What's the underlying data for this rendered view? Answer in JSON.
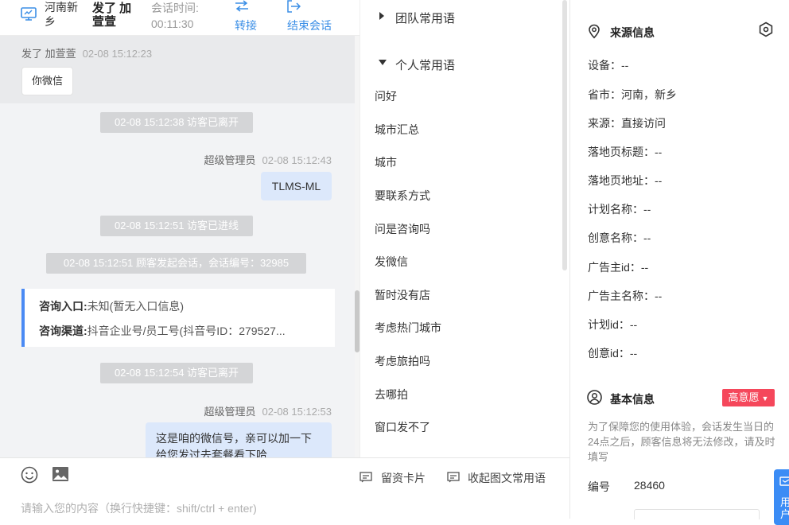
{
  "header": {
    "location": "河南新乡",
    "visitor_name": "发了 加萱萱",
    "session_time_label": "会话时间:",
    "session_time": "00:11:30",
    "transfer_label": "转接",
    "end_session_label": "结束会话"
  },
  "messages": {
    "first": {
      "sender": "发了 加萱萱",
      "time": "02-08 15:12:23",
      "text": "你微信"
    },
    "sys1": "02-08 15:12:38 访客已离开",
    "agent1": {
      "sender": "超级管理员",
      "time": "02-08 15:12:43",
      "text": "TLMS-ML"
    },
    "sys2": "02-08 15:12:51 访客已进线",
    "sys3": "02-08 15:12:51 顾客发起会话，会话编号：32985",
    "card": {
      "entry_label": "咨询入口:",
      "entry_value": "未知(暂无入口信息)",
      "channel_label": "咨询渠道:",
      "channel_value": "抖音企业号/员工号(抖音号ID：279527..."
    },
    "sys4": "02-08 15:12:54 访客已离开",
    "agent2": {
      "sender": "超级管理员",
      "time": "02-08 15:12:53",
      "text_line1": "这是咱的微信号，亲可以加一下",
      "text_line2": "给您发过去套餐看下哈"
    }
  },
  "composer": {
    "emoji_icon": "smile-icon",
    "image_icon": "image-icon",
    "leave_card_label": "留资卡片",
    "collapse_label": "收起图文常用语",
    "placeholder": "请输入您的内容（换行快捷键：shift/ctrl + enter)"
  },
  "phrases": {
    "team_group": "团队常用语",
    "personal_group": "个人常用语",
    "items": [
      "问好",
      "城市汇总",
      "城市",
      "要联系方式",
      "问是咨询吗",
      "发微信",
      "暂时没有店",
      "考虑热门城市",
      "考虑旅拍吗",
      "去哪拍",
      "窗口发不了"
    ]
  },
  "source": {
    "title": "来源信息",
    "fields": [
      "设备：--",
      "省市：河南，新乡",
      "来源：直接访问",
      "落地页标题：--",
      "落地页地址：--",
      "计划名称：--",
      "创意名称：--",
      "广告主id：--",
      "广告主名称：--",
      "计划id：--",
      "创意id：--"
    ]
  },
  "basic": {
    "title": "基本信息",
    "intent_label": "高意愿",
    "notice": "为了保障您的使用体验，会话发生当日的24点之后，顾客信息将无法修改，请及时填写",
    "number_label": "编号",
    "number_value": "28460"
  },
  "float_button": {
    "label": "用户"
  },
  "colors": {
    "accent": "#3a8ee6",
    "intent": "#f5475b",
    "agent_bubble": "#dce8fb",
    "card_border": "#4a8af4"
  }
}
